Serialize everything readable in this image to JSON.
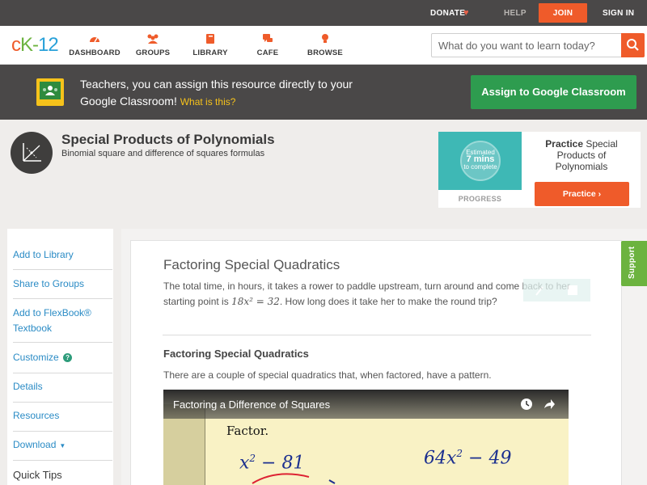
{
  "topbar": {
    "donate": "DONATE",
    "help": "HELP",
    "join": "JOIN",
    "signin": "SIGN IN"
  },
  "nav": {
    "logo": {
      "c": "c",
      "k": "K",
      "dash": "-",
      "n": "12"
    },
    "items": [
      {
        "label": "DASHBOARD",
        "icon": "dashboard-icon"
      },
      {
        "label": "GROUPS",
        "icon": "groups-icon"
      },
      {
        "label": "LIBRARY",
        "icon": "library-icon"
      },
      {
        "label": "CAFE",
        "icon": "cafe-icon"
      },
      {
        "label": "BROWSE",
        "icon": "browse-icon"
      }
    ],
    "search_placeholder": "What do you want to learn today?"
  },
  "banner": {
    "message": "Teachers, you can assign this resource directly to your Google Classroom!",
    "what_link": "What is this?",
    "assign_button": "Assign to Google Classroom"
  },
  "module": {
    "title": "Special Products of Polynomials",
    "subtitle": "Binomial square and difference of squares formulas"
  },
  "practice": {
    "estimate_top": "Estimated",
    "estimate_mid": "7 mins",
    "estimate_bottom": "to complete",
    "progress_label": "PROGRESS",
    "card_bold": "Practice",
    "card_rest": " Special Products of Polynomials",
    "button": "Practice"
  },
  "sidebar": {
    "items": [
      "Add to Library",
      "Share to Groups",
      "Add to FlexBook® Textbook",
      "Customize",
      "Details",
      "Resources",
      "Download"
    ],
    "quick_tips": "Quick Tips"
  },
  "content": {
    "heading": "Factoring Special Quadratics",
    "intro_part1": "The total time, in hours, it takes a rower to paddle upstream, turn around and come back to her starting point is",
    "intro_math": "18x² = 32",
    "intro_part2": ". How long does it take her to make the round trip?",
    "subheading": "Factoring Special Quadratics",
    "subtext": "There are a couple of special quadratics that, when factored, have a pattern."
  },
  "video": {
    "title": "Factoring a Difference of Squares",
    "factor_label": "Factor.",
    "eq1_base": "x",
    "eq1_exp": "2",
    "eq1_rest": " − 81",
    "eq2_base": "64x",
    "eq2_exp": "2",
    "eq2_rest": " − 49"
  },
  "support": "Support",
  "colors": {
    "accent_orange": "#ef5b2a",
    "green": "#2e9c4f",
    "link_blue": "#2a8bc5",
    "dark_bar": "#4a4848"
  }
}
